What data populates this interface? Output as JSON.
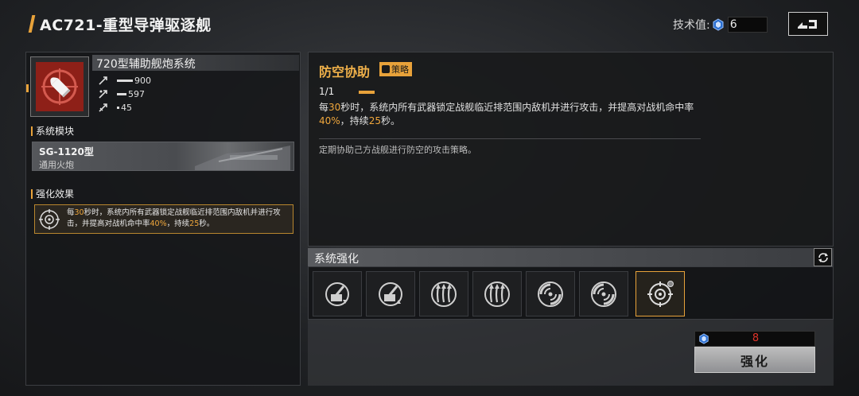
{
  "header": {
    "title": "AC721-重型导弹驱逐舰",
    "tech_label": "技术值:",
    "tech_value": "6",
    "tech_icon": "tech-gem-icon",
    "back_icon": "return-arrow-icon"
  },
  "weapon": {
    "name": "720型辅助舰炮系统",
    "stats": [
      {
        "icon": "damage-icon",
        "value": "900",
        "level": 1.0
      },
      {
        "icon": "range-icon",
        "value": "597",
        "level": 0.6
      },
      {
        "icon": "rate-icon",
        "value": "45",
        "level": 0.1
      }
    ]
  },
  "modules": {
    "heading": "系统模块",
    "module_name": "SG-1120型",
    "module_type": "通用火炮"
  },
  "effects": {
    "heading": "强化效果",
    "text_p1": "每",
    "text_h1": "30",
    "text_p2": "秒时，系统内所有武器锁定战舰临近排范围内敌机并进行攻击，并提高对战机命中率",
    "text_h2": "40%",
    "text_p3": "，持续",
    "text_h3": "25",
    "text_p4": "秒。"
  },
  "skill": {
    "title": "防空协助",
    "tag": "策略",
    "level": "1/1",
    "desc_p1": "每",
    "desc_h1": "30",
    "desc_p2": "秒时，系统内所有武器锁定战舰临近排范围内敌机并进行攻击，并提高对战机命中率",
    "desc_h2": "40%",
    "desc_p3": "，持续",
    "desc_h3": "25",
    "desc_p4": "秒。",
    "flavor": "定期协助己方战舰进行防空的攻击策略。"
  },
  "enhance": {
    "title": "系统强化",
    "refresh_icon": "refresh-icon",
    "slots": [
      {
        "icon": "turret-down-icon",
        "selected": false
      },
      {
        "icon": "turret-up-icon",
        "selected": false
      },
      {
        "icon": "triple-arrow-icon",
        "selected": false
      },
      {
        "icon": "triple-arrow-icon",
        "selected": false
      },
      {
        "icon": "radar-spin-icon",
        "selected": false
      },
      {
        "icon": "radar-spin-icon",
        "selected": false
      },
      {
        "icon": "target-reticle-icon",
        "selected": true
      }
    ]
  },
  "upgrade": {
    "cost": "8",
    "cost_icon": "tech-gem-icon",
    "button_label": "强化"
  },
  "colors": {
    "accent": "#e8a23a",
    "highlight": "#f0a73c",
    "cost_red": "#e0342a"
  }
}
